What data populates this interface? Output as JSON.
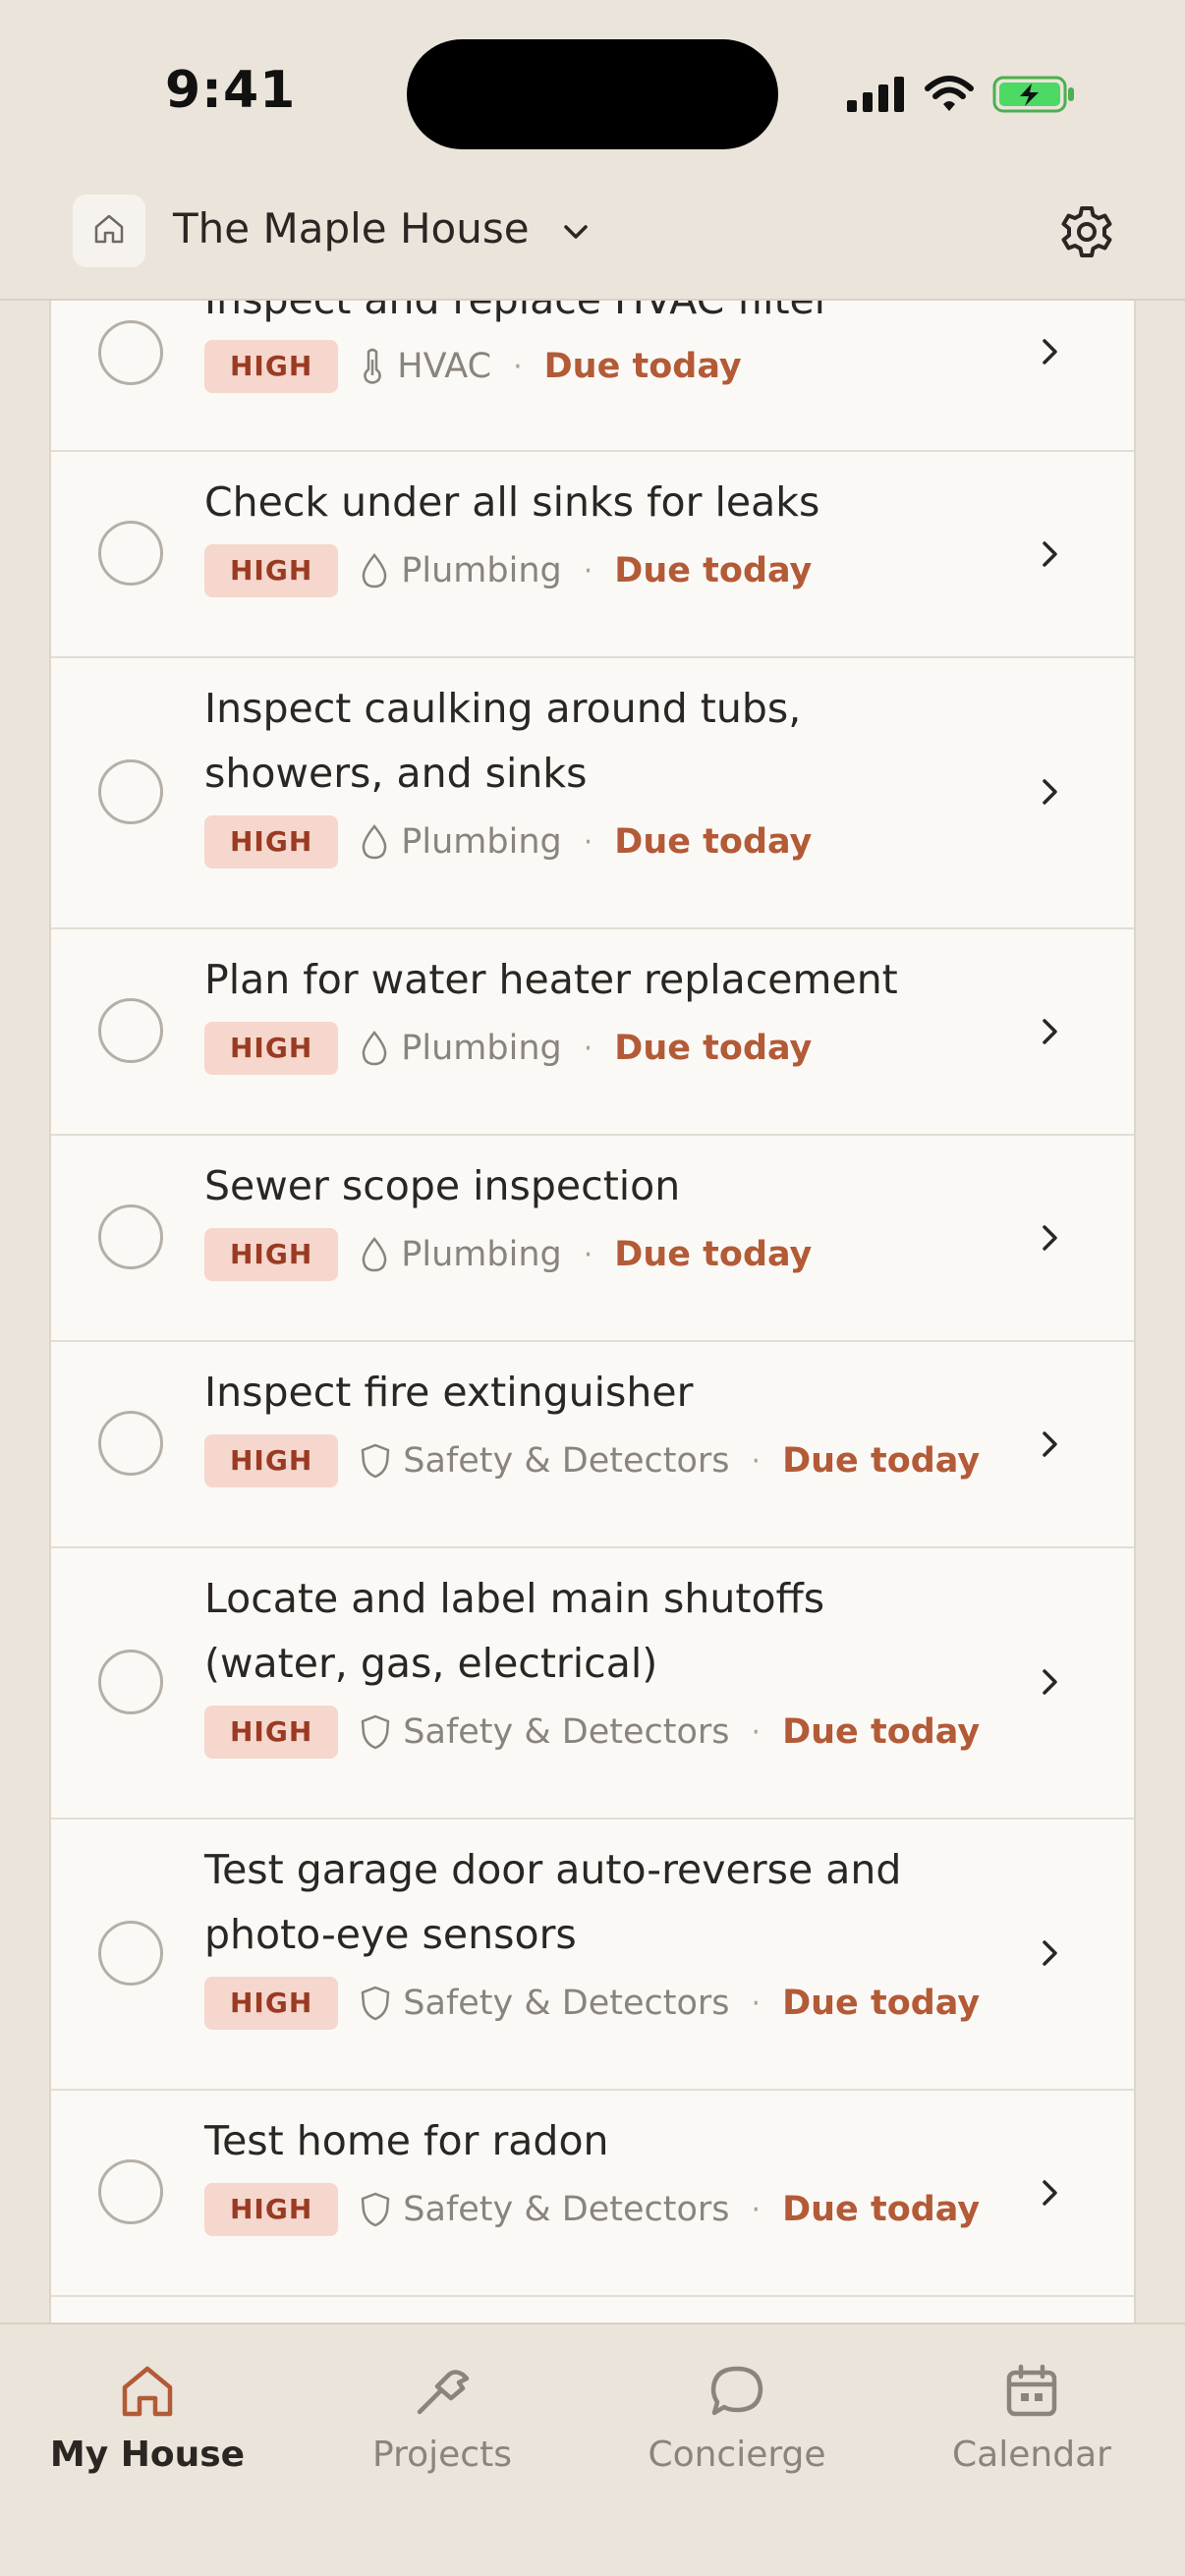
{
  "status_bar": {
    "time": "9:41"
  },
  "header": {
    "house_name": "The Maple House"
  },
  "tasks": [
    {
      "title": "Inspect and replace HVAC filter",
      "priority": "HIGH",
      "category": "HVAC",
      "category_icon": "thermometer-icon",
      "due": "Due today"
    },
    {
      "title": "Check under all sinks for leaks",
      "priority": "HIGH",
      "category": "Plumbing",
      "category_icon": "water-drop-icon",
      "due": "Due today"
    },
    {
      "title": "Inspect caulking around tubs, showers, and sinks",
      "priority": "HIGH",
      "category": "Plumbing",
      "category_icon": "water-drop-icon",
      "due": "Due today"
    },
    {
      "title": "Plan for water heater replacement",
      "priority": "HIGH",
      "category": "Plumbing",
      "category_icon": "water-drop-icon",
      "due": "Due today"
    },
    {
      "title": "Sewer scope inspection",
      "priority": "HIGH",
      "category": "Plumbing",
      "category_icon": "water-drop-icon",
      "due": "Due today"
    },
    {
      "title": "Inspect fire extinguisher",
      "priority": "HIGH",
      "category": "Safety & Detectors",
      "category_icon": "shield-icon",
      "due": "Due today"
    },
    {
      "title": "Locate and label main shutoffs (water, gas, electrical)",
      "priority": "HIGH",
      "category": "Safety & Detectors",
      "category_icon": "shield-icon",
      "due": "Due today"
    },
    {
      "title": "Test garage door auto-reverse and photo-eye sensors",
      "priority": "HIGH",
      "category": "Safety & Detectors",
      "category_icon": "shield-icon",
      "due": "Due today"
    },
    {
      "title": "Test home for radon",
      "priority": "HIGH",
      "category": "Safety & Detectors",
      "category_icon": "shield-icon",
      "due": "Due today"
    }
  ],
  "tab_bar": {
    "tabs": [
      {
        "label": "My House",
        "icon": "home-icon",
        "active": true
      },
      {
        "label": "Projects",
        "icon": "hammer-icon",
        "active": false
      },
      {
        "label": "Concierge",
        "icon": "chat-bubble-icon",
        "active": false
      },
      {
        "label": "Calendar",
        "icon": "calendar-icon",
        "active": false
      }
    ]
  },
  "colors": {
    "background": "#EAE4DA",
    "card": "#FBF9F6",
    "priority_bg": "#F5D7CD",
    "priority_text": "#9A3A22",
    "due_text": "#B35A37",
    "accent_active_tab": "#B35A37"
  }
}
